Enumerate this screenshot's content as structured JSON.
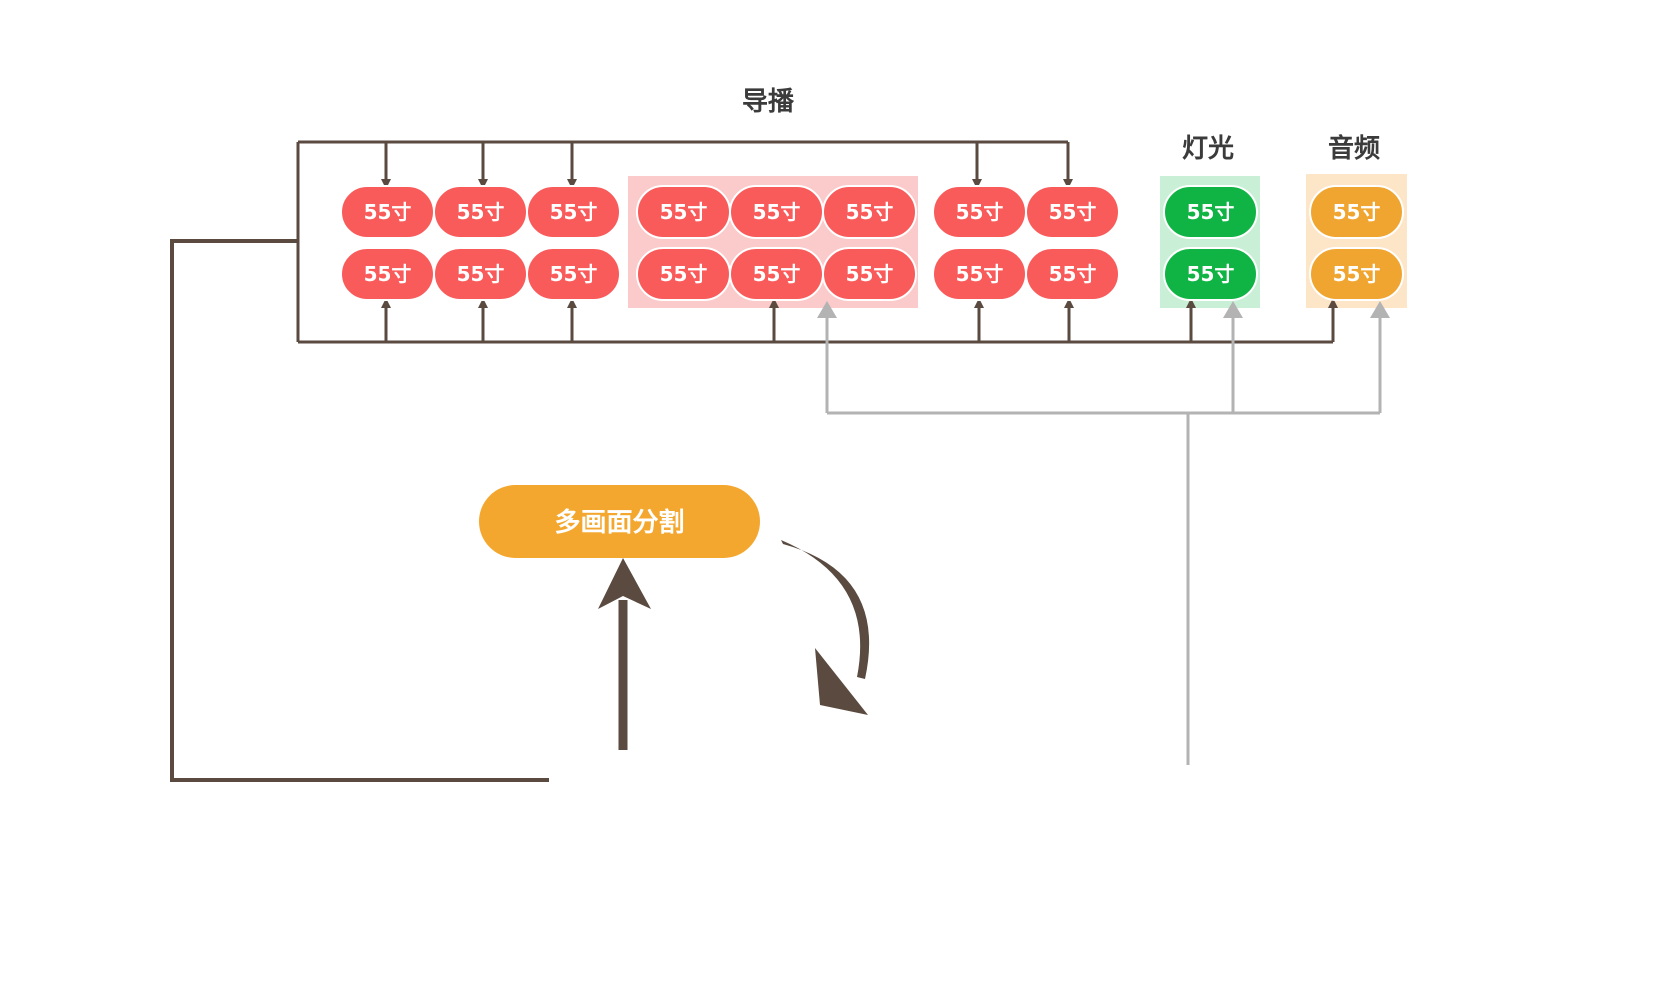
{
  "labels": {
    "director": "导播",
    "lighting": "灯光",
    "audio": "音频",
    "multiview": "多画面分割"
  },
  "screen_label": "55寸",
  "colors": {
    "red_screen": "#f95b5b",
    "green_screen": "#10b445",
    "orange_screen": "#f0a530",
    "highlight_red": "#fbcaca",
    "highlight_green": "#c9f0d6",
    "highlight_orange": "#fde5c8",
    "dark_line": "#5a4a40",
    "grey_line": "#b3b3b3",
    "multiview_button": "#f3a72f"
  },
  "groups": [
    {
      "id": "director-left",
      "color": "red",
      "columns": 3
    },
    {
      "id": "director-center",
      "color": "red",
      "columns": 3
    },
    {
      "id": "director-right",
      "color": "red",
      "columns": 2
    },
    {
      "id": "lighting",
      "color": "green",
      "columns": 1
    },
    {
      "id": "audio",
      "color": "orange",
      "columns": 1
    }
  ]
}
